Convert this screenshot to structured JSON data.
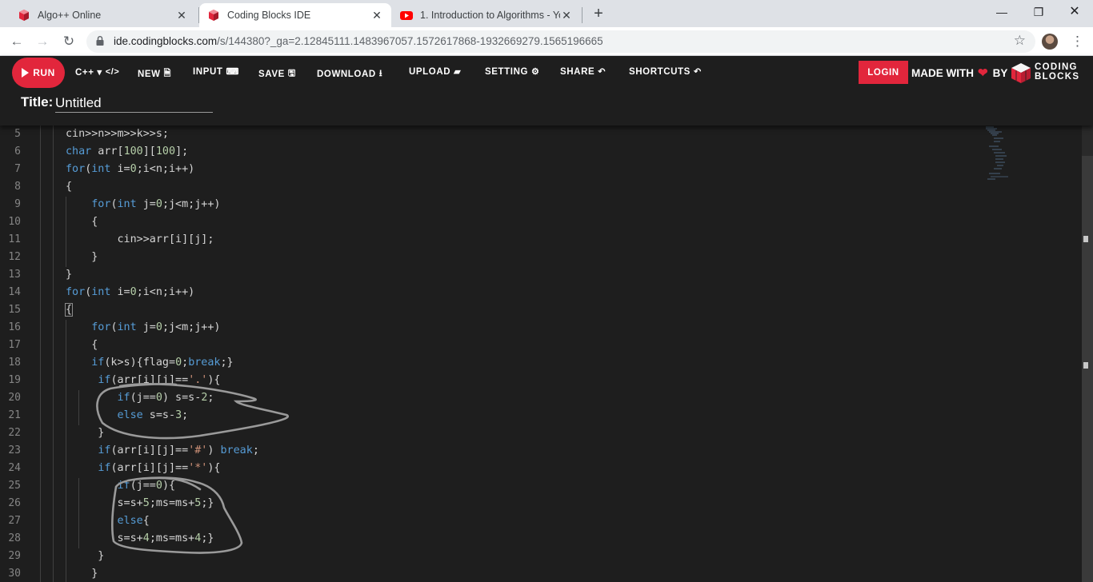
{
  "browser": {
    "tabs": [
      {
        "title": "Algo++ Online",
        "favicon": "coding-blocks-favicon"
      },
      {
        "title": "Coding Blocks IDE",
        "favicon": "coding-blocks-favicon"
      },
      {
        "title": "1. Introduction to Algorithms - Yo",
        "favicon": "youtube-favicon"
      }
    ],
    "new_tab_label": "+",
    "address": {
      "host": "ide.codingblocks.com",
      "path": "/s/144380?_ga=2.12845111.1483967057.1572617868-1932669279.1565196665"
    }
  },
  "ide": {
    "run_label": "RUN",
    "menu": [
      {
        "label": "C++ ▾",
        "icon": "</>"
      },
      {
        "label": "NEW",
        "icon": "🗎"
      },
      {
        "label": "INPUT",
        "icon": "⌨"
      },
      {
        "label": "SAVE",
        "icon": "🖫"
      },
      {
        "label": "DOWNLOAD",
        "icon": "⭳"
      },
      {
        "label": "UPLOAD",
        "icon": "▰"
      },
      {
        "label": "SETTING",
        "icon": "⚙"
      },
      {
        "label": "SHARE",
        "icon": "↶"
      },
      {
        "label": "SHORTCUTS",
        "icon": "↶"
      }
    ],
    "login_label": "LOGIN",
    "made_with": "MADE WITH",
    "by": "BY",
    "logo_line1": "CODING",
    "logo_line2": "BLOCKS",
    "title_label": "Title:",
    "title_value": "Untitled"
  },
  "editor": {
    "line_numbers": [
      "5",
      "6",
      "7",
      "8",
      "9",
      "10",
      "11",
      "12",
      "13",
      "14",
      "15",
      "16",
      "17",
      "18",
      "19",
      "20",
      "21",
      "22",
      "23",
      "24",
      "25",
      "26",
      "27",
      "28",
      "29",
      "30"
    ],
    "lines": [
      "cin>>n>>m>>k>>s;",
      "char arr[100][100];",
      "for(int i=0;i<n;i++)",
      "{",
      "    for(int j=0;j<m;j++)",
      "    {",
      "        cin>>arr[i][j];",
      "    }",
      "}",
      "for(int i=0;i<n;i++)",
      "{",
      "    for(int j=0;j<m;j++)",
      "    {",
      "    if(k>s){flag=0;break;}",
      "     if(arr[i][j]=='.'){",
      "        if(j==0) s=s-2;",
      "        else s=s-3;",
      "     }",
      "     if(arr[i][j]=='#') break;",
      "     if(arr[i][j]=='*'){",
      "        if(j==0){",
      "        s=s+5;ms=ms+5;}",
      "        else{",
      "        s=s+4;ms=ms+4;}",
      "     }",
      "    }"
    ]
  },
  "colors": {
    "accent_red": "#e2263c",
    "editor_bg": "#1e1e1e",
    "keyword": "#569cd6",
    "number": "#b5cea8",
    "string": "#ce9178"
  }
}
